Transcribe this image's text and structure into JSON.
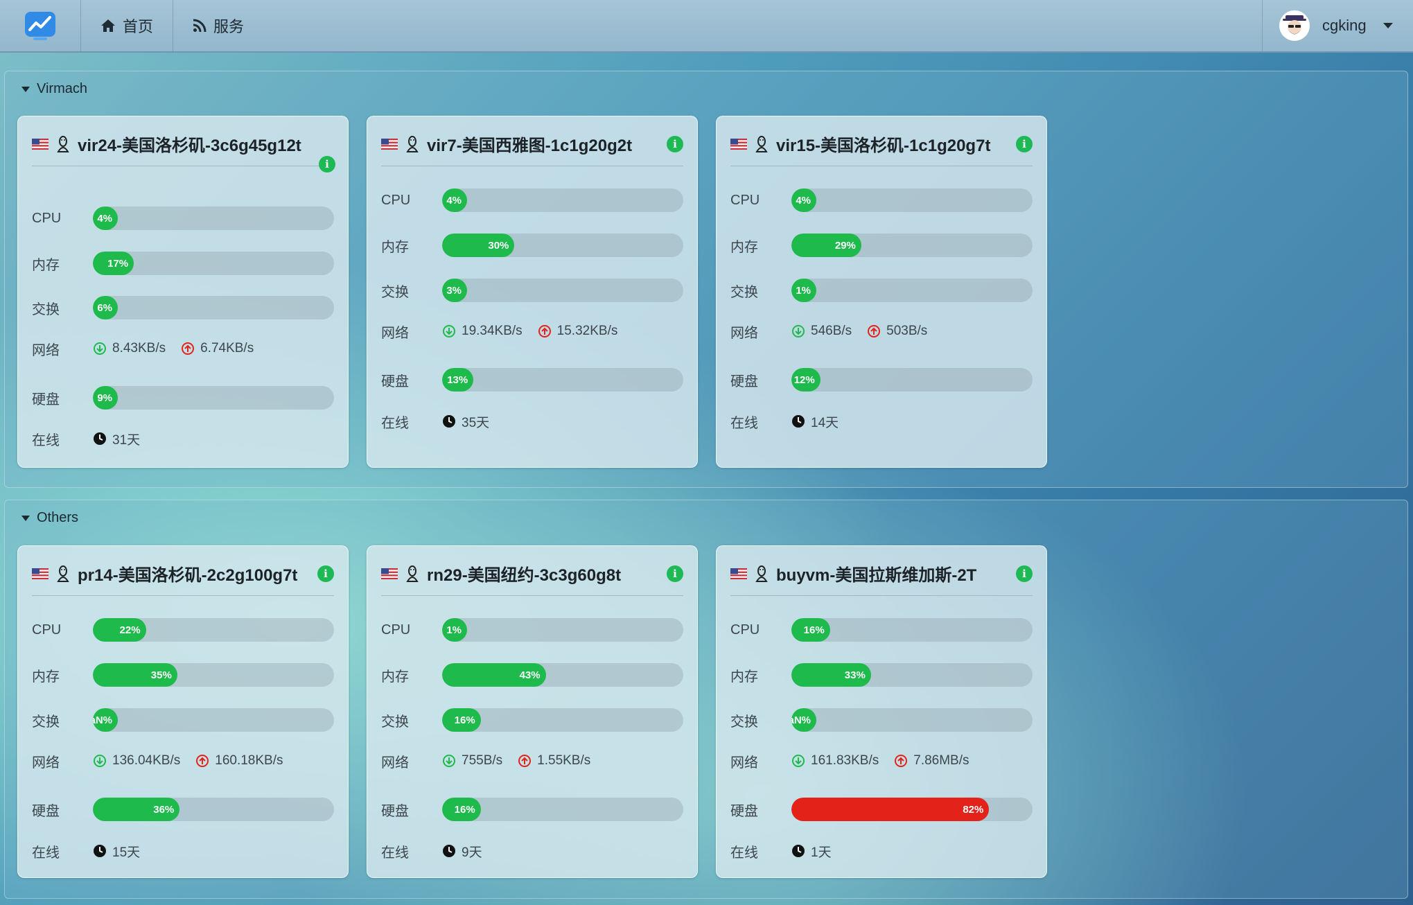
{
  "nav": {
    "home_label": "首页",
    "services_label": "服务",
    "username": "cgking"
  },
  "labels": {
    "cpu": "CPU",
    "mem": "内存",
    "swap": "交换",
    "net": "网络",
    "disk": "硬盘",
    "online": "在线"
  },
  "colors": {
    "ok": "#1fba4c",
    "danger": "#e3231a",
    "info": "#1db954"
  },
  "groups": [
    {
      "name": "Virmach",
      "servers": [
        {
          "title": "vir24-美国洛杉矶-3c6g45g12t",
          "cpu": 4,
          "cpu_text": "4%",
          "mem": 17,
          "mem_text": "17%",
          "swap": 6,
          "swap_text": "6%",
          "net_down": "8.43KB/s",
          "net_up": "6.74KB/s",
          "disk": 9,
          "disk_text": "9%",
          "uptime": "31天",
          "info_wrapped": true
        },
        {
          "title": "vir7-美国西雅图-1c1g20g2t",
          "cpu": 4,
          "cpu_text": "4%",
          "mem": 30,
          "mem_text": "30%",
          "swap": 3,
          "swap_text": "3%",
          "net_down": "19.34KB/s",
          "net_up": "15.32KB/s",
          "disk": 13,
          "disk_text": "13%",
          "uptime": "35天"
        },
        {
          "title": "vir15-美国洛杉矶-1c1g20g7t",
          "cpu": 4,
          "cpu_text": "4%",
          "mem": 29,
          "mem_text": "29%",
          "swap": 1,
          "swap_text": "1%",
          "net_down": "546B/s",
          "net_up": "503B/s",
          "disk": 12,
          "disk_text": "12%",
          "uptime": "14天"
        }
      ]
    },
    {
      "name": "Others",
      "servers": [
        {
          "title": "pr14-美国洛杉矶-2c2g100g7t",
          "cpu": 22,
          "cpu_text": "22%",
          "mem": 35,
          "mem_text": "35%",
          "swap": 0,
          "swap_text": "NaN%",
          "net_down": "136.04KB/s",
          "net_up": "160.18KB/s",
          "disk": 36,
          "disk_text": "36%",
          "uptime": "15天"
        },
        {
          "title": "rn29-美国纽约-3c3g60g8t",
          "cpu": 1,
          "cpu_text": "1%",
          "mem": 43,
          "mem_text": "43%",
          "swap": 16,
          "swap_text": "16%",
          "net_down": "755B/s",
          "net_up": "1.55KB/s",
          "disk": 16,
          "disk_text": "16%",
          "uptime": "9天"
        },
        {
          "title": "buyvm-美国拉斯维加斯-2T",
          "cpu": 16,
          "cpu_text": "16%",
          "mem": 33,
          "mem_text": "33%",
          "swap": 0,
          "swap_text": "NaN%",
          "net_down": "161.83KB/s",
          "net_up": "7.86MB/s",
          "disk": 82,
          "disk_text": "82%",
          "uptime": "1天"
        }
      ]
    }
  ]
}
